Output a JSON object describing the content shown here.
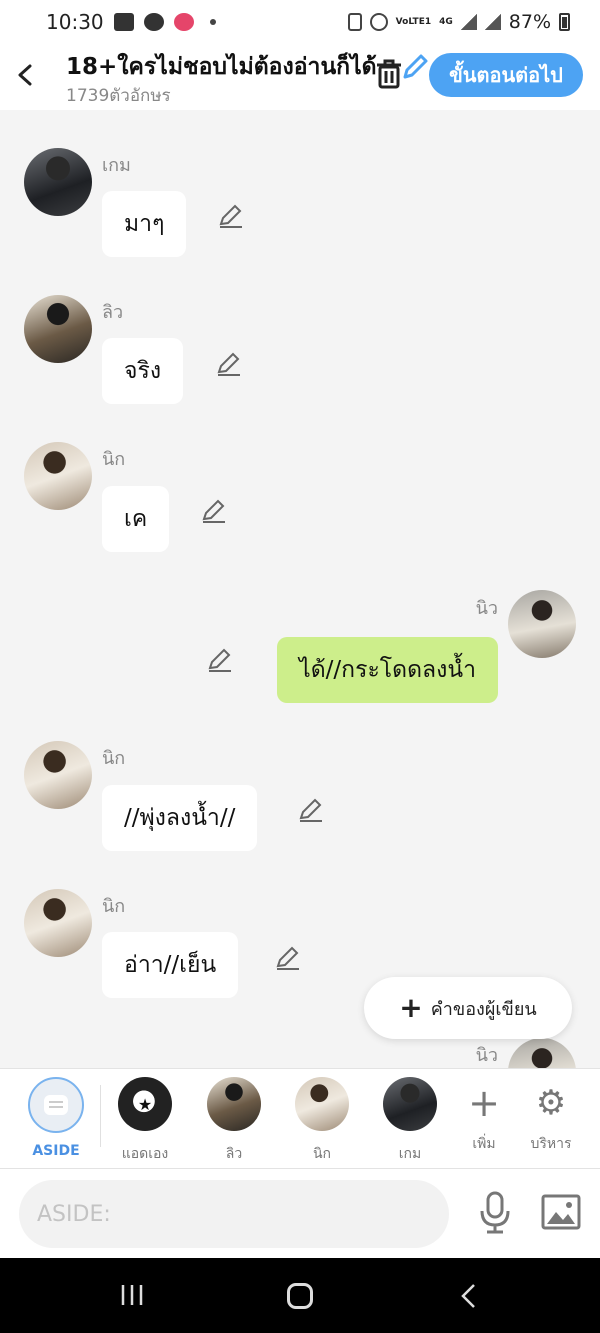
{
  "status": {
    "time": "10:30",
    "volte": "VoLTE1",
    "network": "4G",
    "battery": "87%"
  },
  "header": {
    "title": "18+ใครไม่ชอบไม่ต้องอ่านก็ได้",
    "char_count": "1739ตัวอักษร",
    "next_label": "ขั้นตอนต่อไป"
  },
  "messages": [
    {
      "sender": "เกม",
      "text": "มาๆ",
      "avatar": "a1",
      "side": "left"
    },
    {
      "sender": "ลิว",
      "text": "จริง",
      "avatar": "a2",
      "side": "left"
    },
    {
      "sender": "นิก",
      "text": "เค",
      "avatar": "a3",
      "side": "left"
    },
    {
      "sender": "นิว",
      "text": "ได้//กระโดดลงน้ำ",
      "avatar": "a4",
      "side": "right"
    },
    {
      "sender": "นิก",
      "text": "//พุ่งลงน้ำ//",
      "avatar": "a3",
      "side": "left"
    },
    {
      "sender": "นิก",
      "text": "อ่าา//เย็น",
      "avatar": "a3",
      "side": "left"
    },
    {
      "sender": "นิว",
      "avatar": "a4",
      "side": "right"
    }
  ],
  "author_note_label": "คำของผู้เขียน",
  "characters": {
    "aside_label": "ASIDE",
    "items": [
      {
        "label": "แอดเอง"
      },
      {
        "label": "ลิว"
      },
      {
        "label": "นิก"
      },
      {
        "label": "เกม"
      }
    ],
    "add_label": "เพิ่ม",
    "manage_label": "บริหาร"
  },
  "input": {
    "placeholder": "ASIDE:"
  },
  "colors": {
    "accent": "#4da3f3",
    "my_bubble": "#cdee8b",
    "background": "#f4f4f4"
  },
  "icons": [
    "back-arrow-icon",
    "trash-icon",
    "pencil-icon",
    "mic-icon",
    "image-icon",
    "gear-icon",
    "plus-icon"
  ]
}
